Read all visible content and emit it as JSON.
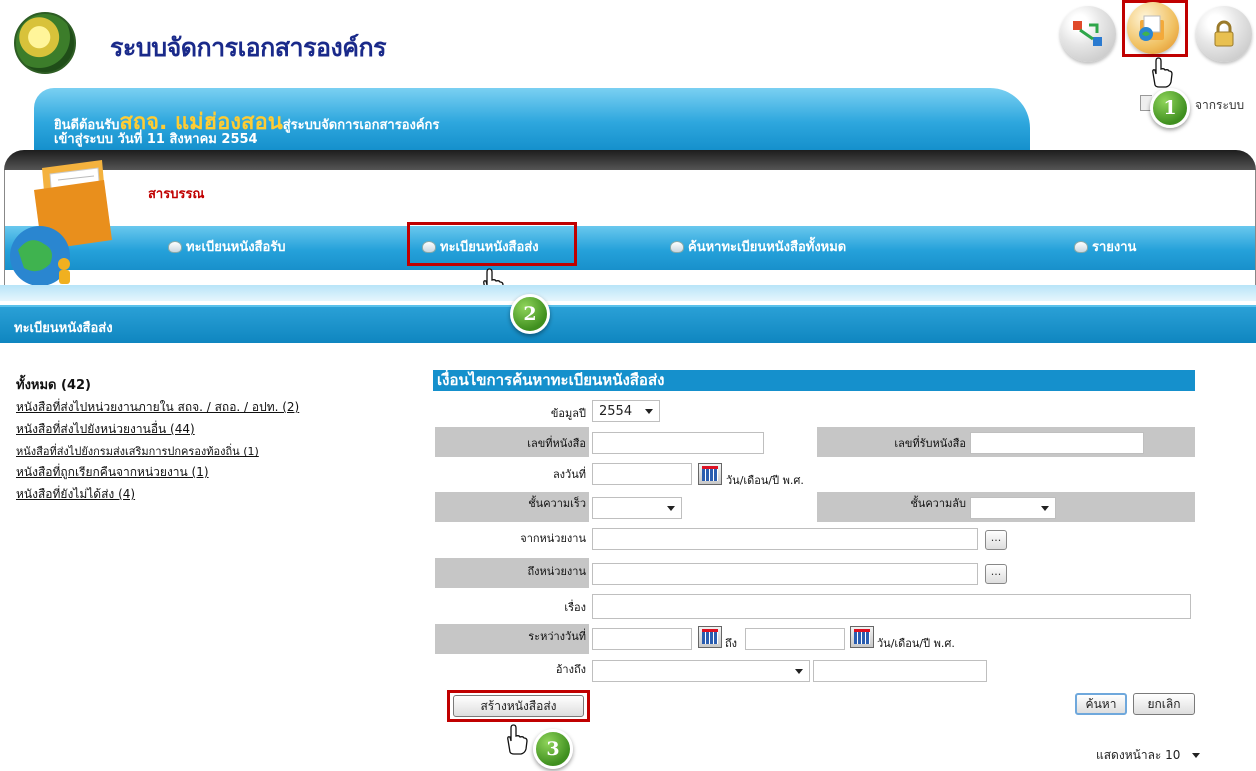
{
  "header": {
    "app_title": "ระบบจัดการเอกสารองค์กร",
    "icons": [
      "workflow-icon",
      "document-folder-icon",
      "lock-icon"
    ]
  },
  "welcome": {
    "prefix": "ยินดีต้อนรับ",
    "organization": "สถจ. แม่ฮ่องสอน",
    "suffix": "สู่ระบบจัดการเอกสารองค์กร",
    "login_line": "เข้าสู่ระบบ วันที่ 11 สิงหาคม 2554",
    "logout_partial": "จากระบบ"
  },
  "menu": {
    "section": "สารบรรณ",
    "items": [
      "ทะเบียนหนังสือรับ",
      "ทะเบียนหนังสือส่ง",
      "ค้นหาทะเบียนหนังสือทั้งหมด",
      "รายงาน"
    ]
  },
  "page_title": "ทะเบียนหนังสือส่ง",
  "summary": {
    "total": "ทั้งหมด (42)",
    "links": [
      "หนังสือที่ส่งไปหน่วยงานภายใน สถจ. / สถอ. / อปท. (2)",
      "หนังสือที่ส่งไปยังหน่วยงานอื่น (44)",
      "หนังสือที่ส่งไปยังกรมส่งเสริมการปกครองท้องถิ่น (1)",
      "หนังสือที่ถูกเรียกคืนจากหน่วยงาน (1)",
      "หนังสือที่ยังไม่ได้ส่ง (4)"
    ]
  },
  "search_form": {
    "title": "เงื่อนไขการค้นหาทะเบียนหนังสือส่ง",
    "year_label": "ข้อมูลปี",
    "year_value": "2554",
    "doc_no_label": "เลขที่หนังสือ",
    "recv_no_label": "เลขที่รับหนังสือ",
    "date_label": "ลงวันที่",
    "date_hint": "วัน/เดือน/ปี พ.ศ.",
    "urgency_label": "ชั้นความเร็ว",
    "secrecy_label": "ชั้นความลับ",
    "from_label": "จากหน่วยงาน",
    "to_label": "ถึงหน่วยงาน",
    "subject_label": "เรื่อง",
    "between_label": "ระหว่างวันที่",
    "to_word": "ถึง",
    "ref_label": "อ้างถึง",
    "browse_label": "..."
  },
  "buttons": {
    "create": "สร้างหนังสือส่ง",
    "search": "ค้นหา",
    "cancel": "ยกเลิก"
  },
  "pager": {
    "per_page": "แสดงหน้าละ 10"
  },
  "steps": [
    "1",
    "2",
    "3"
  ],
  "colors": {
    "accent_blue": "#1590cc",
    "highlight_red": "#c00000",
    "step_green": "#3f8f1f",
    "org_yellow": "#ffcc33"
  }
}
